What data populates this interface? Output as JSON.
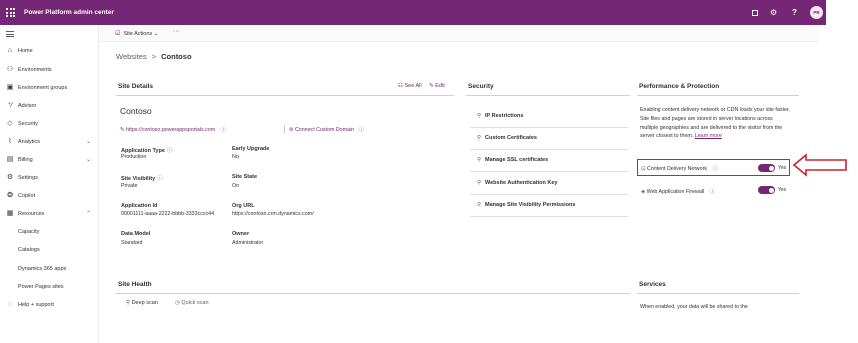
{
  "app": {
    "title": "Power Platform admin center",
    "user_initials": "PR"
  },
  "sidebar": {
    "items": [
      {
        "label": "Home",
        "icon": "home-icon",
        "glyph": "⌂"
      },
      {
        "label": "Environments",
        "icon": "environments-icon",
        "glyph": "⚇"
      },
      {
        "label": "Environment groups",
        "icon": "environment-groups-icon",
        "glyph": "▣"
      },
      {
        "label": "Advisor",
        "icon": "advisor-icon",
        "glyph": "⁺⁄"
      },
      {
        "label": "Security",
        "icon": "security-icon",
        "glyph": "◇"
      },
      {
        "label": "Analytics",
        "icon": "analytics-icon",
        "glyph": "⌇"
      },
      {
        "label": "Billing",
        "icon": "billing-icon",
        "glyph": "▤"
      },
      {
        "label": "Settings",
        "icon": "settings-icon",
        "glyph": "⚙"
      },
      {
        "label": "Copilot",
        "icon": "copilot-icon",
        "glyph": "❂"
      },
      {
        "label": "Resources",
        "icon": "resources-icon",
        "glyph": "▦"
      },
      {
        "label": "Capacity",
        "icon": "",
        "glyph": ""
      },
      {
        "label": "Catalogs",
        "icon": "",
        "glyph": ""
      },
      {
        "label": "Dynamics 365 apps",
        "icon": "",
        "glyph": ""
      },
      {
        "label": "Power Pages sites",
        "icon": "",
        "glyph": ""
      },
      {
        "label": "Help + support",
        "icon": "help-support-icon",
        "glyph": "◌"
      }
    ]
  },
  "commandbar": {
    "site_actions": "Site Actions",
    "more": "···"
  },
  "breadcrumb": {
    "parent": "Websites",
    "separator": ">",
    "current": "Contoso"
  },
  "site_details": {
    "title": "Site Details",
    "see_all": "See All",
    "edit": "Edit",
    "name": "Contoso",
    "url": "https://contoso.powerappsportals.com",
    "connect_domain": "Connect Custom Domain",
    "fields": {
      "application_type": {
        "label": "Application Type",
        "value": "Production"
      },
      "early_upgrade": {
        "label": "Early Upgrade",
        "value": "No"
      },
      "site_visibility": {
        "label": "Site Visibility",
        "value": "Private"
      },
      "site_state": {
        "label": "Site State",
        "value": "On"
      },
      "application_id": {
        "label": "Application Id",
        "value": "00001111-aaaa-2222-bbbb-3333cccc44"
      },
      "org_url": {
        "label": "Org URL",
        "value": "https://contoso.crm.dynamics.com/"
      },
      "data_model": {
        "label": "Data Model",
        "value": "Standard"
      },
      "owner": {
        "label": "Owner",
        "value": "Administrator"
      }
    }
  },
  "security": {
    "title": "Security",
    "items": [
      "IP Restrictions",
      "Custom Certificates",
      "Manage SSL certificates",
      "Website Authentication Key",
      "Manage Site Visibility Permissions"
    ]
  },
  "performance": {
    "title": "Performance & Protection",
    "description": "Enabling content delivery network or CDN loads your site faster. Site files and pages are stored in server locations across multiple geographies and are delivered to the visitor from the server closest to them.",
    "learn_more": "Learn more",
    "cdn": {
      "label": "Content Delivery Network",
      "state": "Yes",
      "on": true
    },
    "waf": {
      "label": "Web Application Firewall",
      "state": "Yes",
      "on": true
    }
  },
  "site_health": {
    "title": "Site Health",
    "deep_scan": "Deep scan",
    "quick_scan": "Quick scan"
  },
  "services": {
    "title": "Services",
    "description": "When enabled, your data will be shared to the"
  },
  "colors": {
    "brand": "#742774",
    "highlight": "#c4262e"
  }
}
